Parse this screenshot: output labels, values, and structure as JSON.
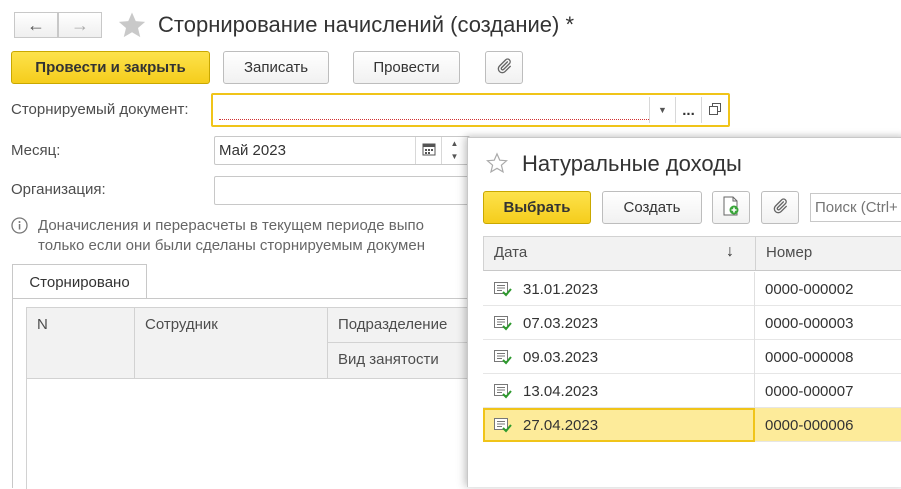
{
  "window": {
    "title": "Сторнирование начислений (создание) *"
  },
  "toolbar": {
    "post_close": "Провести и закрыть",
    "save": "Записать",
    "post": "Провести"
  },
  "form": {
    "stornodoc_label": "Сторнируемый документ:",
    "stornodoc_value": "",
    "month_label": "Месяц:",
    "month_value": "Май 2023",
    "org_label": "Организация:",
    "org_value": "",
    "info_line1": "Доначисления и перерасчеты в текущем периоде выпо",
    "info_line2": "только если они были сделаны сторнируемым докумен",
    "more_button": "..."
  },
  "tabs": [
    {
      "label": "Сторнировано"
    }
  ],
  "table": {
    "col_n": "N",
    "col_employee": "Сотрудник",
    "col_department": "Подразделение",
    "col_employment": "Вид занятости"
  },
  "popup": {
    "title": "Натуральные доходы",
    "select_button": "Выбрать",
    "create_button": "Создать",
    "search_placeholder": "Поиск (Ctrl+F)",
    "columns": {
      "date": "Дата",
      "number": "Номер",
      "sort_indicator": "↓"
    },
    "rows": [
      {
        "date": "31.01.2023",
        "number": "0000-000002",
        "selected": false
      },
      {
        "date": "07.03.2023",
        "number": "0000-000003",
        "selected": false
      },
      {
        "date": "09.03.2023",
        "number": "0000-000008",
        "selected": false
      },
      {
        "date": "13.04.2023",
        "number": "0000-000007",
        "selected": false
      },
      {
        "date": "27.04.2023",
        "number": "0000-000006",
        "selected": true
      }
    ]
  },
  "colors": {
    "accent": "#f5cd1c",
    "selected_row": "#fdeb9a",
    "selected_border": "#f0c419"
  }
}
